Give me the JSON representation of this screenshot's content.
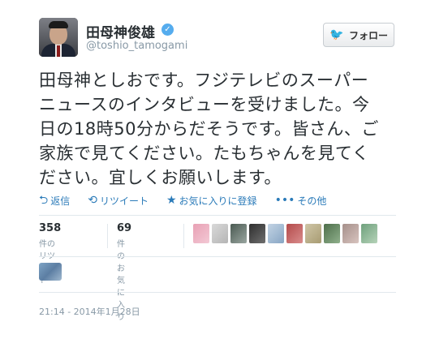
{
  "user": {
    "name": "田母神俊雄",
    "screen_name": "@toshio_tamogami"
  },
  "follow_button": {
    "label": "フォロー"
  },
  "tweet": {
    "lines": [
      "田母神としおです。フジテレビのスーパー",
      "ニュースのインタビューを受けました。今",
      "日の18時50分からだそうです。皆さん、ご",
      "家族で見てください。たもちゃんを見てく",
      "ださい。宜しくお願いします。"
    ]
  },
  "actions": {
    "reply": "返信",
    "retweet": "リツイート",
    "favorite": "お気に入りに登録",
    "more": "その他"
  },
  "stats": {
    "retweets": {
      "count": "358",
      "label": "件のリツイート"
    },
    "favorites": {
      "count": "69",
      "label": "件のお気に入り"
    }
  },
  "timestamp": "21:14 - 2014年1月28日",
  "colors": {
    "accent": "#2b7bb9",
    "verified": "#55acee",
    "muted": "#8899a6"
  }
}
